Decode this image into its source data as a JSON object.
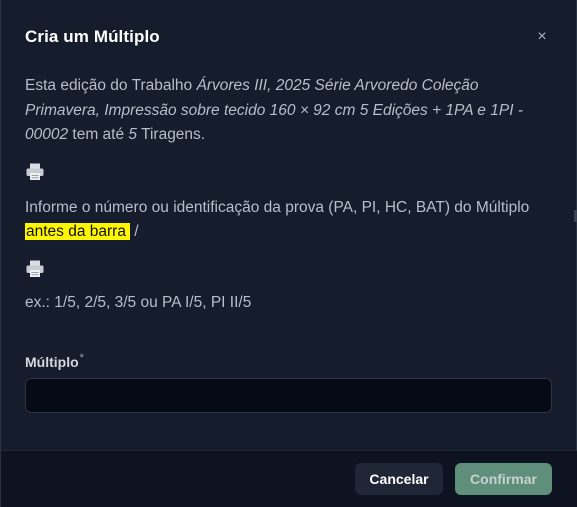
{
  "dialog": {
    "title": "Cria um Múltiplo",
    "close_icon": "×"
  },
  "description": {
    "prefix": "Esta edição do Trabalho ",
    "artwork_italic": "Árvores III, 2025 Série Arvoredo Coleção Primavera, Impressão sobre tecido 160 × 92 cm 5 Edições + 1PA e 1PI - 00002",
    "middle": " tem até ",
    "count_italic": "5",
    "suffix": " Tiragens."
  },
  "instruction": {
    "text_before": "Informe o número ou identificação da prova (PA, PI, HC, BAT) do Múltiplo ",
    "highlight": "antes da barra",
    "text_after": " /"
  },
  "example": "ex.: 1/5, 2/5, 3/5 ou PA I/5, PI II/5",
  "field": {
    "label": "Múltiplo",
    "required_mark": "*",
    "value": ""
  },
  "buttons": {
    "cancel": "Cancelar",
    "confirm": "Confirmar"
  },
  "icons": {
    "print": "printer-icon",
    "close": "close-icon"
  },
  "colors": {
    "highlight": "#fff700",
    "confirm_button": "#6ea48b",
    "background": "#151d2c"
  }
}
